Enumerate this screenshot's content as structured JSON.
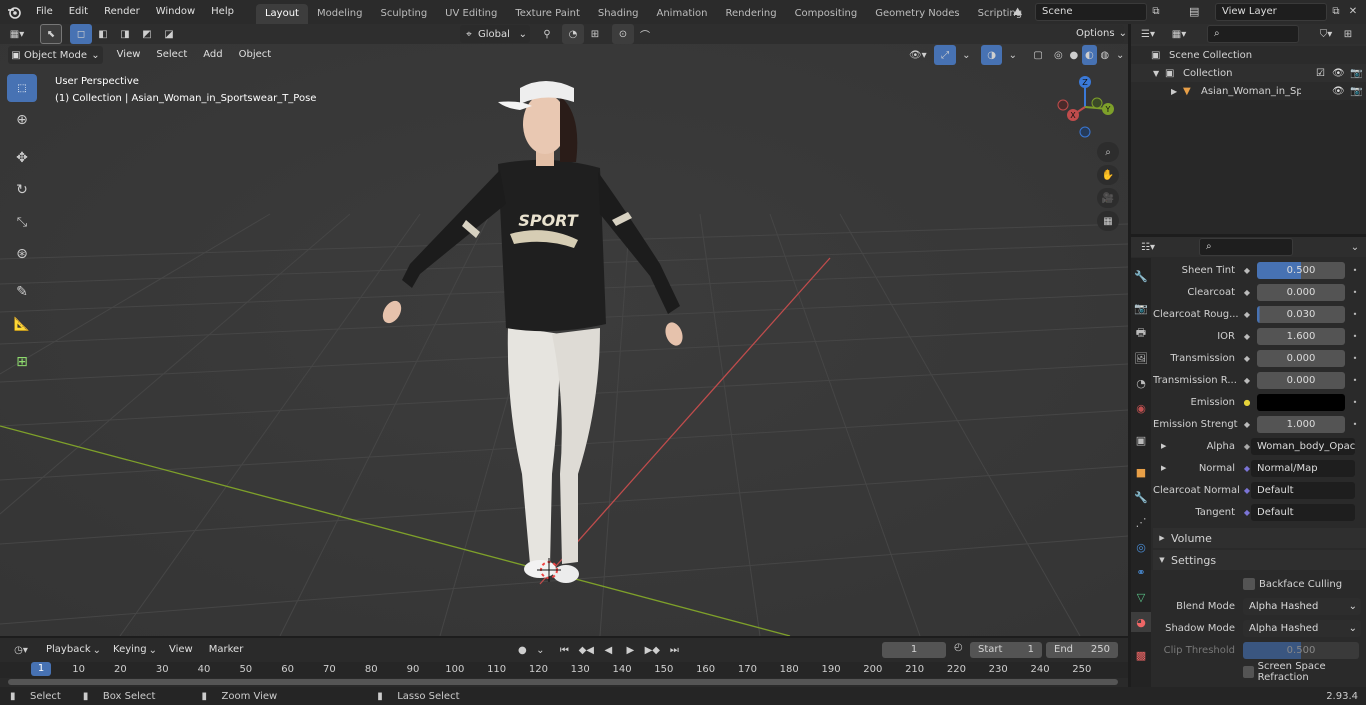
{
  "topbar": {
    "menus": [
      "File",
      "Edit",
      "Render",
      "Window",
      "Help"
    ],
    "workspaces": [
      "Layout",
      "Modeling",
      "Sculpting",
      "UV Editing",
      "Texture Paint",
      "Shading",
      "Animation",
      "Rendering",
      "Compositing",
      "Geometry Nodes",
      "Scripting"
    ],
    "active_workspace": "Layout",
    "add_tab": "+",
    "scene": "Scene",
    "view_layer": "View Layer"
  },
  "viewport": {
    "mode": "Object Mode",
    "menus": [
      "View",
      "Select",
      "Add",
      "Object"
    ],
    "orientation": "Global",
    "options": "Options",
    "overlay_title": "User Perspective",
    "overlay_subtitle": "(1) Collection | Asian_Woman_in_Sportswear_T_Pose",
    "gizmo": {
      "z": "Z",
      "y": "Y",
      "x": "X"
    },
    "shirt_text": "SPORT"
  },
  "outliner": {
    "root": "Scene Collection",
    "collection": "Collection",
    "object": "Asian_Woman_in_Sportsw"
  },
  "properties": {
    "rows": [
      {
        "label": "Sheen Tint",
        "value": "0.500"
      },
      {
        "label": "Clearcoat",
        "value": "0.000"
      },
      {
        "label": "Clearcoat Roug...",
        "value": "0.030"
      },
      {
        "label": "IOR",
        "value": "1.600"
      },
      {
        "label": "Transmission",
        "value": "0.000"
      },
      {
        "label": "Transmission R...",
        "value": "0.000"
      },
      {
        "label": "Emission",
        "value": ""
      },
      {
        "label": "Emission Strengt",
        "value": "1.000"
      }
    ],
    "links": [
      {
        "label": "Alpha",
        "value": "Woman_body_Opac..."
      },
      {
        "label": "Normal",
        "value": "Normal/Map"
      },
      {
        "label": "Clearcoat Normal",
        "value": "Default"
      },
      {
        "label": "Tangent",
        "value": "Default"
      }
    ],
    "volume_panel": "Volume",
    "settings_panel": "Settings",
    "backface_culling": "Backface Culling",
    "blend_mode_label": "Blend Mode",
    "blend_mode": "Alpha Hashed",
    "shadow_mode_label": "Shadow Mode",
    "shadow_mode": "Alpha Hashed",
    "clip_threshold_label": "Clip Threshold",
    "clip_threshold": "0.500",
    "ssr": "Screen Space Refraction"
  },
  "timeline": {
    "menus": [
      "Playback",
      "Keying",
      "View",
      "Marker"
    ],
    "current_frame": "1",
    "start_label": "Start",
    "start": "1",
    "end_label": "End",
    "end": "250",
    "ticks": [
      "1",
      "10",
      "20",
      "30",
      "40",
      "50",
      "60",
      "70",
      "80",
      "90",
      "100",
      "110",
      "120",
      "130",
      "140",
      "150",
      "160",
      "170",
      "180",
      "190",
      "200",
      "210",
      "220",
      "230",
      "240",
      "250"
    ]
  },
  "statusbar": {
    "select": "Select",
    "box_select": "Box Select",
    "zoom_view": "Zoom View",
    "lasso_select": "Lasso Select",
    "version": "2.93.4"
  },
  "colors": {
    "accent": "#4772b3",
    "viewport_bg": "#393939",
    "x_axis": "#c04c4c",
    "y_axis": "#7ea02a"
  }
}
